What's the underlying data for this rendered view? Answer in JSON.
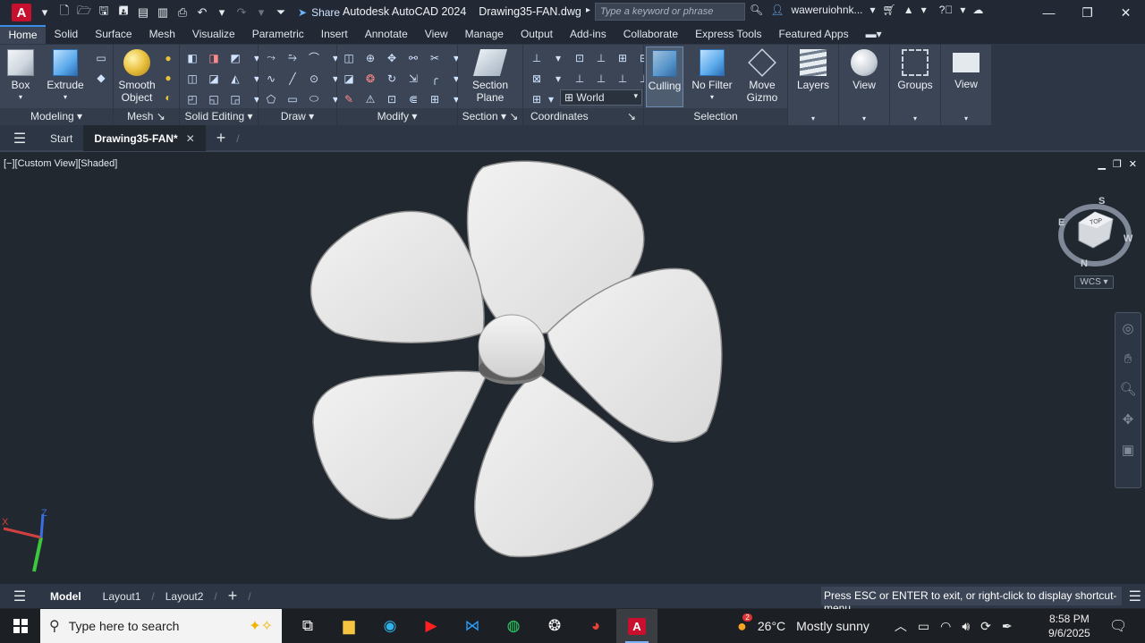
{
  "titlebar": {
    "logo": "A",
    "share_label": "Share",
    "app_name": "Autodesk AutoCAD 2024",
    "file_name": "Drawing35-FAN.dwg",
    "search_placeholder": "Type a keyword or phrase",
    "user": "waweruiohnk..."
  },
  "ribbon_tabs": [
    "Home",
    "Solid",
    "Surface",
    "Mesh",
    "Visualize",
    "Parametric",
    "Insert",
    "Annotate",
    "View",
    "Manage",
    "Output",
    "Add-ins",
    "Collaborate",
    "Express Tools",
    "Featured Apps"
  ],
  "ribbon": {
    "modeling": {
      "label": "Modeling",
      "box": "Box",
      "extrude": "Extrude"
    },
    "mesh": {
      "label": "Mesh",
      "smooth_object_1": "Smooth",
      "smooth_object_2": "Object"
    },
    "solid_editing": {
      "label": "Solid Editing"
    },
    "draw": {
      "label": "Draw"
    },
    "modify": {
      "label": "Modify"
    },
    "section": {
      "label": "Section",
      "section_plane_1": "Section",
      "section_plane_2": "Plane"
    },
    "coordinates": {
      "label": "Coordinates",
      "world": "World"
    },
    "selection": {
      "label": "Selection",
      "culling": "Culling",
      "no_filter": "No Filter",
      "move_gizmo_1": "Move",
      "move_gizmo_2": "Gizmo"
    },
    "layers": "Layers",
    "view1": "View",
    "groups": "Groups",
    "view2": "View"
  },
  "file_tabs": {
    "start": "Start",
    "drawing": "Drawing35-FAN*"
  },
  "viewport": {
    "label": "[−][Custom View][Shaded]",
    "viewcube_face": "TOP",
    "compass": {
      "n": "N",
      "s": "S",
      "e": "E",
      "w": "W"
    },
    "wcs": "WCS",
    "ucs_x": "X",
    "ucs_z": "Z"
  },
  "layout_tabs": [
    "Model",
    "Layout1",
    "Layout2"
  ],
  "command_line": "Press ESC or ENTER to exit, or right-click to display shortcut-menu.",
  "taskbar": {
    "search_placeholder": "Type here to search",
    "weather_temp": "26°C",
    "weather_desc": "Mostly sunny",
    "weather_badge": "2",
    "time": "8:58 PM",
    "date": "9/6/2025"
  },
  "colors": {
    "accent": "#3a8ee6",
    "ribbon_bg": "#3b4555",
    "viewport_bg": "#212830",
    "autocad_red": "#c8102e"
  }
}
